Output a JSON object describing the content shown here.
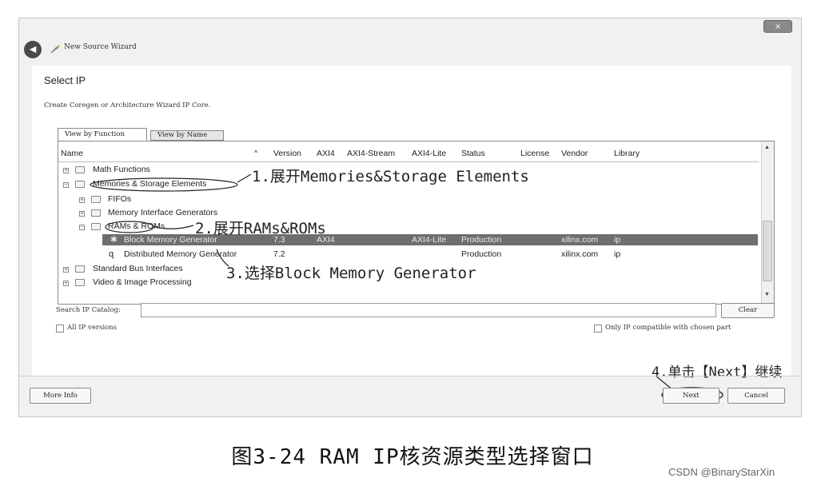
{
  "window": {
    "title": "New Source Wizard",
    "close_glyph": "×",
    "back_glyph": "◄"
  },
  "page": {
    "heading": "Select IP",
    "description": "Create Coregen or Architecture Wizard IP Core."
  },
  "tabs": [
    {
      "label": "View by Function"
    },
    {
      "label": "View by Name"
    }
  ],
  "columns": [
    "Name",
    "Version",
    "AXI4",
    "AXI4-Stream",
    "AXI4-Lite",
    "Status",
    "License",
    "Vendor",
    "Library"
  ],
  "sort_glyph": "^",
  "tree": {
    "math": "Math Functions",
    "memories": "Memories & Storage Elements",
    "fifos": "FIFOs",
    "mig": "Memory Interface Generators",
    "rams": "RAMs & ROMs",
    "block": {
      "name": "Block Memory Generator",
      "version": "7.3",
      "axi4": "AXI4",
      "axi4lite": "AXI4-Lite",
      "status": "Production",
      "vendor": "xilinx.com",
      "library": "ip"
    },
    "dist": {
      "name": "Distributed Memory Generator",
      "version": "7.2",
      "status": "Production",
      "vendor": "xilinx.com",
      "library": "ip"
    },
    "bus": "Standard Bus Interfaces",
    "video": "Video & Image Processing"
  },
  "annotations": {
    "a1": "1.展开Memories&Storage Elements",
    "a2": "2.展开RAMs&ROMs",
    "a3": "3.选择Block Memory Generator",
    "a4": "4.单击【Next】继续"
  },
  "search": {
    "label": "Search IP Catalog:",
    "value": "",
    "clear": "Clear"
  },
  "options": {
    "all_versions": "All IP versions",
    "only_compatible": "Only IP compatible with chosen part"
  },
  "buttons": {
    "more_info": "More Info",
    "next": "Next",
    "cancel": "Cancel"
  },
  "caption": "图3-24   RAM IP核资源类型选择窗口",
  "watermark": "CSDN @BinaryStarXin"
}
